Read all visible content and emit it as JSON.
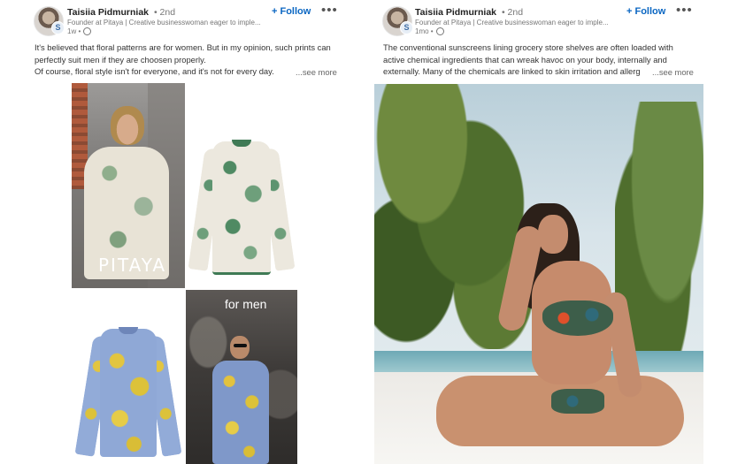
{
  "posts": [
    {
      "author": "Taisiia Pidmurniak",
      "degree": "• 2nd",
      "headline": "Founder at Pitaya | Creative businesswoman eager to imple...",
      "time": "1w •",
      "follow_label": "+ Follow",
      "more_label": "•••",
      "text_lines": [
        "It's believed that floral patterns are for women. But in my opinion, such prints can",
        "perfectly suit men if they are choosen properly.",
        "Of course, floral style isn't for everyone, and it's not for every day."
      ],
      "see_more": "...see more",
      "images": {
        "brand_overlay": "PITAYA",
        "tagline_overlay": "for men"
      }
    },
    {
      "author": "Taisiia Pidmurniak",
      "degree": "• 2nd",
      "headline": "Founder at Pitaya | Creative businesswoman eager to imple...",
      "time": "1mo •",
      "follow_label": "+ Follow",
      "more_label": "•••",
      "text_lines": [
        "The conventional sunscreens lining grocery store shelves are often loaded with",
        "active chemical ingredients that can wreak havoc on your body, internally and",
        "externally. Many of the chemicals are linked to skin irritation and allerg"
      ],
      "see_more": "...see more"
    }
  ],
  "colors": {
    "accent": "#0a66c2",
    "text": "#191919",
    "muted": "#777777"
  },
  "icons": {
    "globe": "globe-icon",
    "more": "more-icon",
    "avatar_badge": "S"
  }
}
